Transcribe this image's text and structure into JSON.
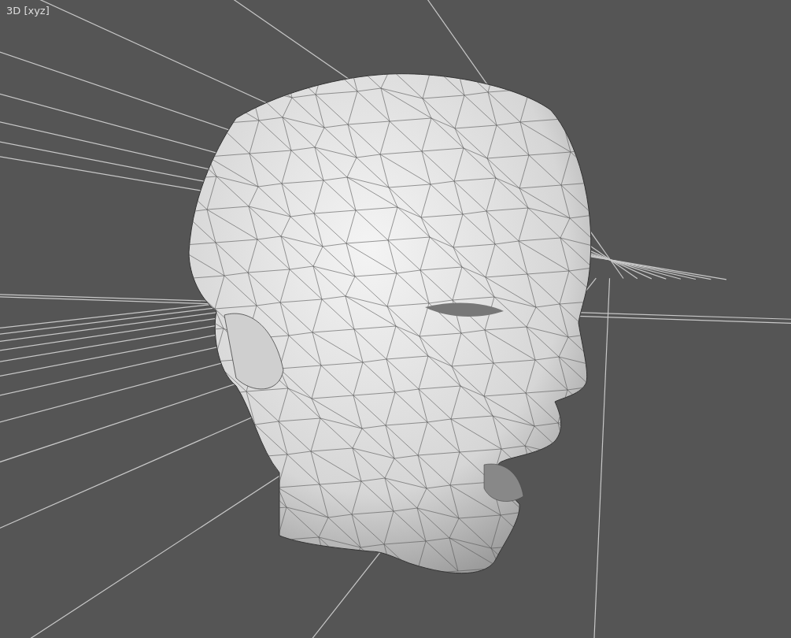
{
  "viewport": {
    "label": "3D [xyz]"
  }
}
